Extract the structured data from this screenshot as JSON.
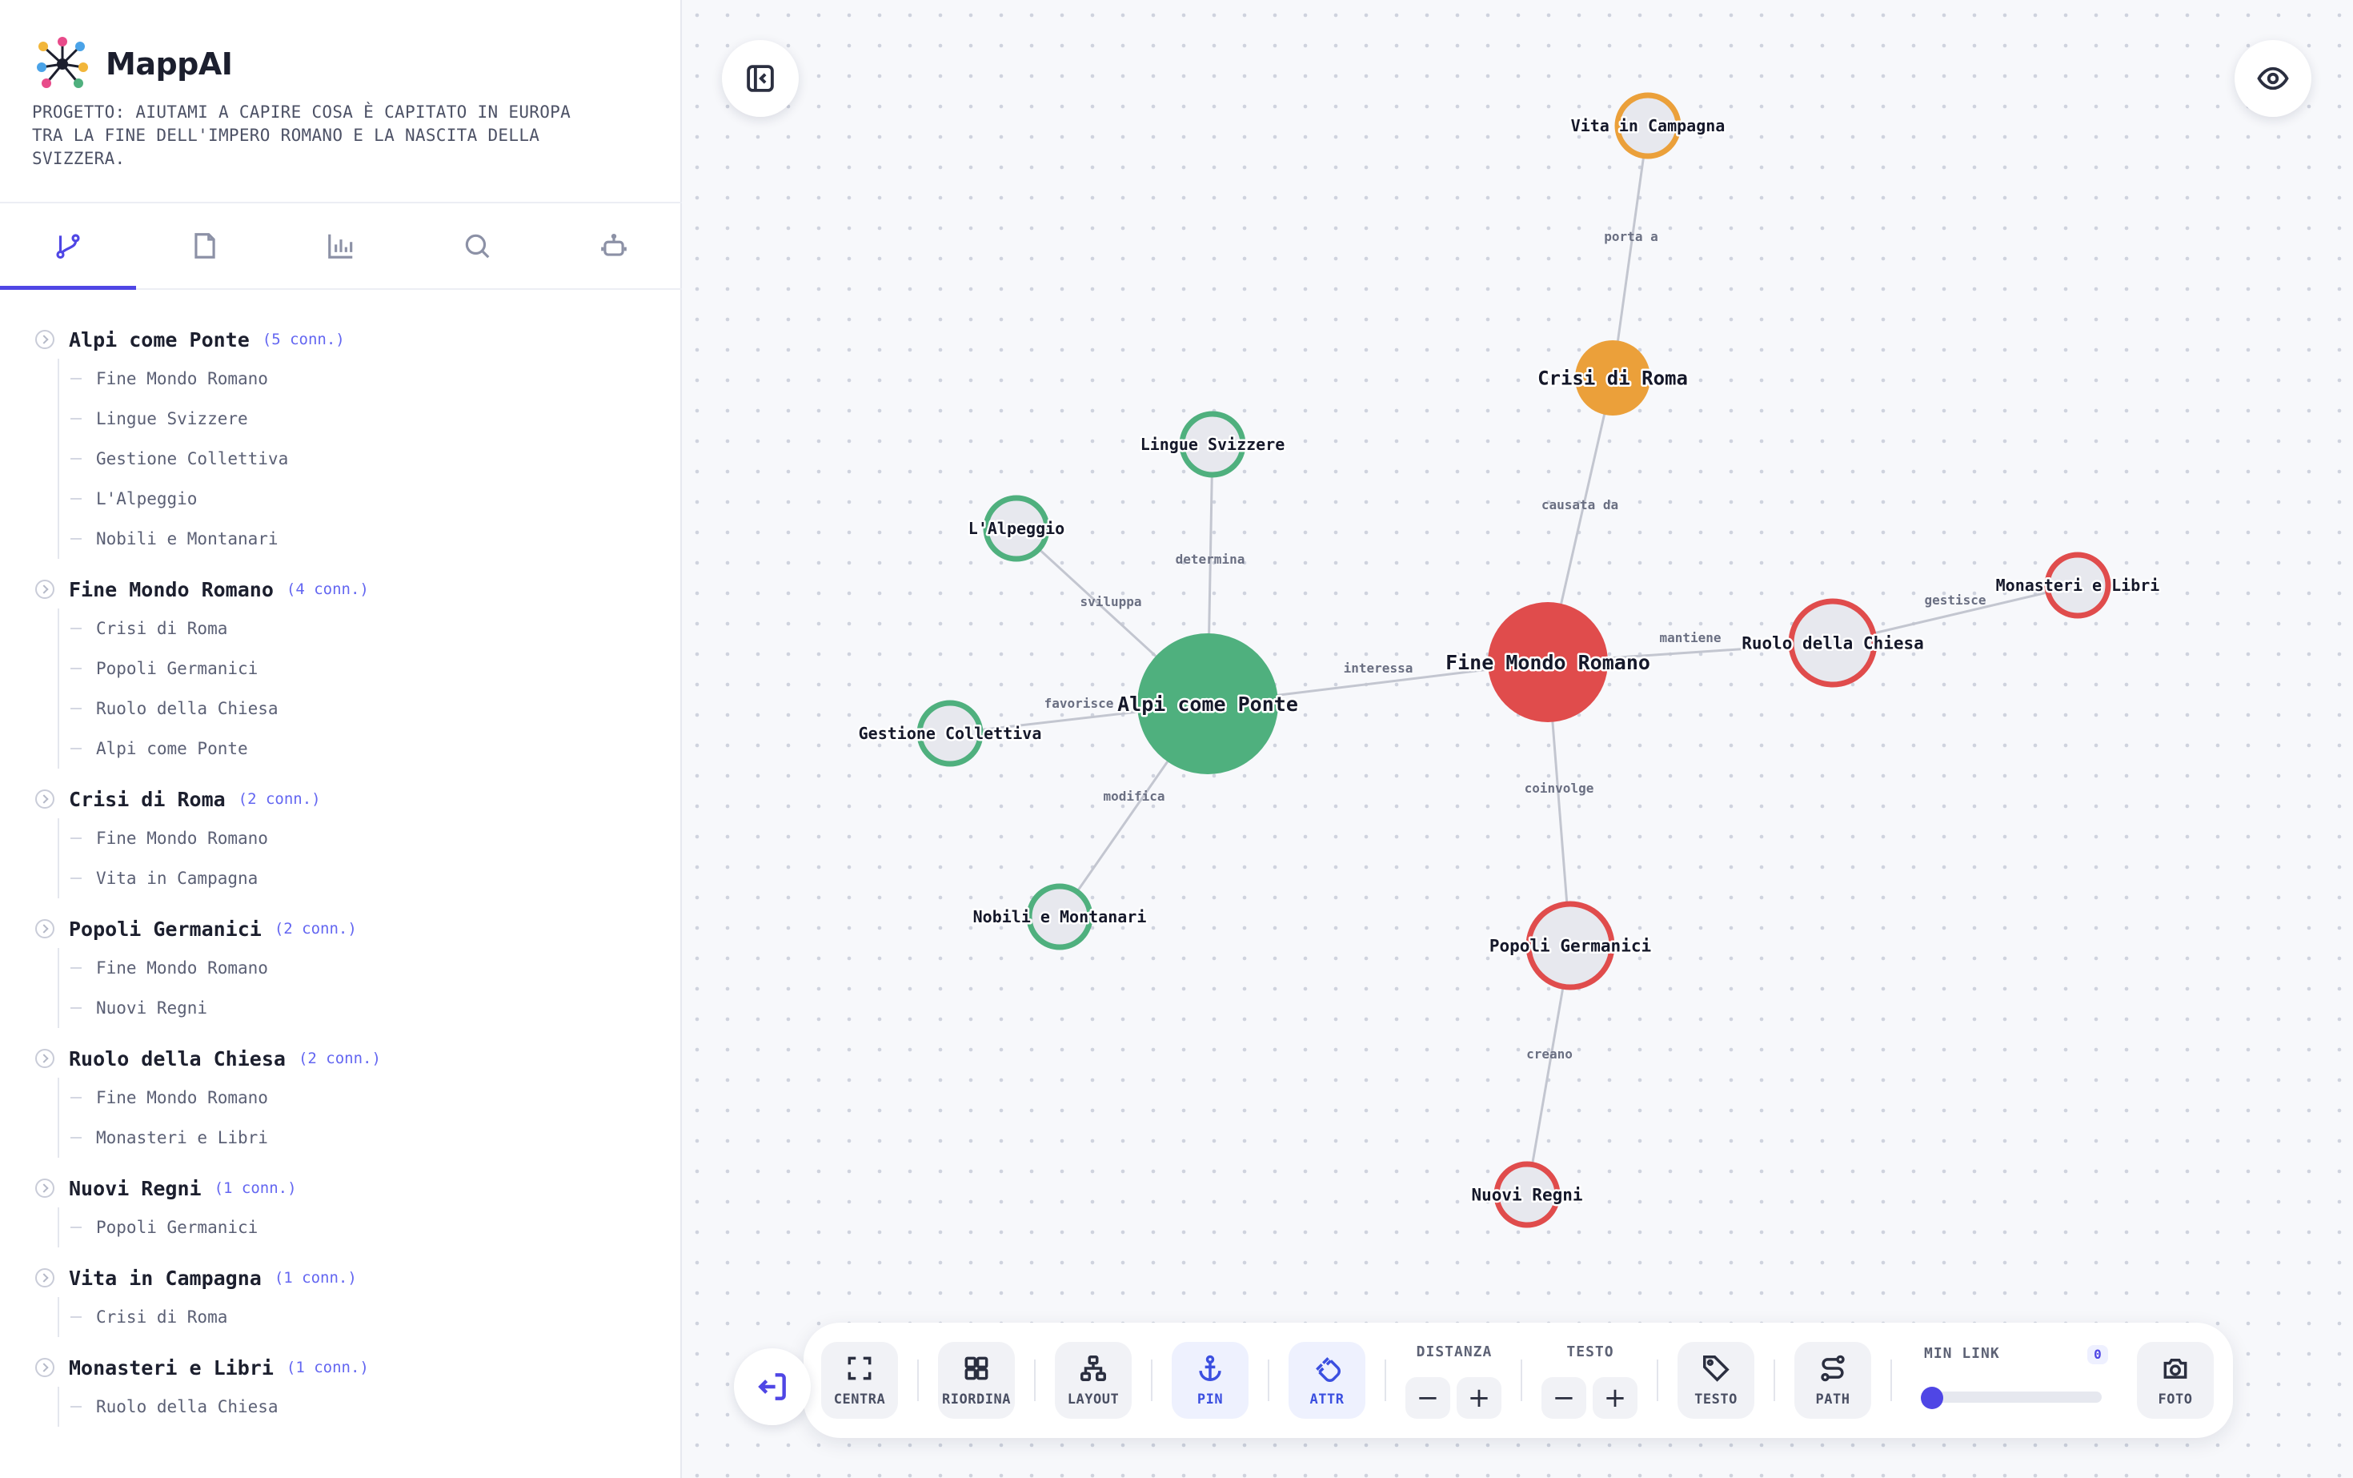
{
  "app": {
    "name": "MappAI",
    "project": "PROGETTO: AIUTAMI A CAPIRE COSA È CAPITATO IN EUROPA TRA LA FINE DELL'IMPERO ROMANO E LA NASCITA DELLA SVIZZERA."
  },
  "tabs": [
    {
      "icon": "git-branch-icon",
      "active": true
    },
    {
      "icon": "document-icon",
      "active": false
    },
    {
      "icon": "bar-chart-icon",
      "active": false
    },
    {
      "icon": "search-icon",
      "active": false
    },
    {
      "icon": "robot-icon",
      "active": false
    }
  ],
  "tree": [
    {
      "title": "Alpi come Ponte",
      "count": "(5 conn.)",
      "children": [
        "Fine Mondo Romano",
        "Lingue Svizzere",
        "Gestione Collettiva",
        "L'Alpeggio",
        "Nobili e Montanari"
      ]
    },
    {
      "title": "Fine Mondo Romano",
      "count": "(4 conn.)",
      "children": [
        "Crisi di Roma",
        "Popoli Germanici",
        "Ruolo della Chiesa",
        "Alpi come Ponte"
      ]
    },
    {
      "title": "Crisi di Roma",
      "count": "(2 conn.)",
      "children": [
        "Fine Mondo Romano",
        "Vita in Campagna"
      ]
    },
    {
      "title": "Popoli Germanici",
      "count": "(2 conn.)",
      "children": [
        "Fine Mondo Romano",
        "Nuovi Regni"
      ]
    },
    {
      "title": "Ruolo della Chiesa",
      "count": "(2 conn.)",
      "children": [
        "Fine Mondo Romano",
        "Monasteri e Libri"
      ]
    },
    {
      "title": "Nuovi Regni",
      "count": "(1 conn.)",
      "children": [
        "Popoli Germanici"
      ]
    },
    {
      "title": "Vita in Campagna",
      "count": "(1 conn.)",
      "children": [
        "Crisi di Roma"
      ]
    },
    {
      "title": "Monasteri e Libri",
      "count": "(1 conn.)",
      "children": [
        "Ruolo della Chiesa"
      ]
    }
  ],
  "graph": {
    "colors": {
      "green": "#4fb07e",
      "red": "#e04c4c",
      "orange": "#eba03a",
      "ring_fill": "#e7e8ee",
      "edge": "#c3c6d0"
    },
    "nodes": [
      {
        "id": "vita",
        "label": "Vita in Campagna",
        "color": "orange",
        "kind": "ring"
      },
      {
        "id": "crisi",
        "label": "Crisi di Roma",
        "color": "orange",
        "kind": "filled"
      },
      {
        "id": "lingue",
        "label": "Lingue Svizzere",
        "color": "green",
        "kind": "ring"
      },
      {
        "id": "alpeggio",
        "label": "L'Alpeggio",
        "color": "green",
        "kind": "ring"
      },
      {
        "id": "alpi",
        "label": "Alpi come Ponte",
        "color": "green",
        "kind": "filled"
      },
      {
        "id": "gestione",
        "label": "Gestione Collettiva",
        "color": "green",
        "kind": "ring"
      },
      {
        "id": "nobili",
        "label": "Nobili e Montanari",
        "color": "green",
        "kind": "ring"
      },
      {
        "id": "fine",
        "label": "Fine Mondo Romano",
        "color": "red",
        "kind": "filled"
      },
      {
        "id": "ruolo",
        "label": "Ruolo della Chiesa",
        "color": "red",
        "kind": "ring"
      },
      {
        "id": "monasteri",
        "label": "Monasteri e Libri",
        "color": "red",
        "kind": "ring"
      },
      {
        "id": "popoli",
        "label": "Popoli Germanici",
        "color": "red",
        "kind": "ring"
      },
      {
        "id": "nuovi",
        "label": "Nuovi Regni",
        "color": "red",
        "kind": "ring"
      }
    ],
    "edges": [
      {
        "from": "crisi",
        "to": "vita",
        "label": "porta a"
      },
      {
        "from": "fine",
        "to": "crisi",
        "label": "causata da"
      },
      {
        "from": "alpi",
        "to": "lingue",
        "label": "determina"
      },
      {
        "from": "alpi",
        "to": "alpeggio",
        "label": "sviluppa"
      },
      {
        "from": "alpi",
        "to": "fine",
        "label": "interessa"
      },
      {
        "from": "alpi",
        "to": "gestione",
        "label": "favorisce"
      },
      {
        "from": "alpi",
        "to": "nobili",
        "label": "modifica"
      },
      {
        "from": "fine",
        "to": "ruolo",
        "label": "mantiene"
      },
      {
        "from": "ruolo",
        "to": "monasteri",
        "label": "gestisce"
      },
      {
        "from": "fine",
        "to": "popoli",
        "label": "coinvolge"
      },
      {
        "from": "popoli",
        "to": "nuovi",
        "label": "creano"
      }
    ]
  },
  "canvas_buttons": {
    "collapse_icon": "sidebar-collapse-icon",
    "visibility_icon": "eye-icon",
    "exit_icon": "exit-icon"
  },
  "toolbar": {
    "centra": "CENTRA",
    "riordina": "RIORDINA",
    "layout": "LAYOUT",
    "pin": "PIN",
    "attr": "ATTR",
    "distanza": "DISTANZA",
    "testo_title": "TESTO",
    "testo": "TESTO",
    "path": "PATH",
    "min_link": "MIN LINK",
    "min_link_value": "0",
    "foto": "FOTO",
    "minus": "−",
    "plus": "+"
  }
}
